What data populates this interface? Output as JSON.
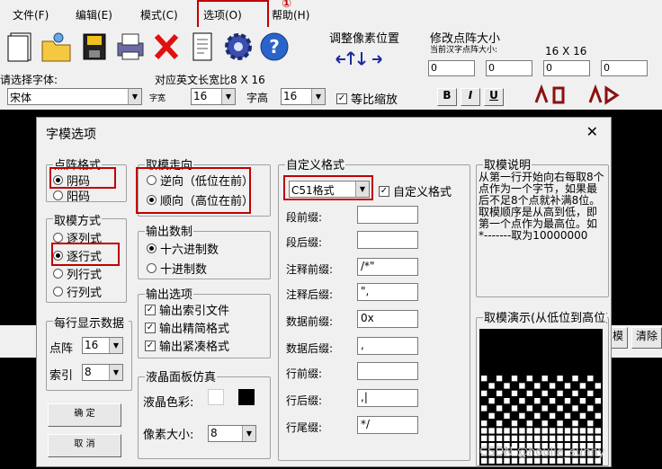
{
  "menu": {
    "items": [
      "文件(F)",
      "编辑(E)",
      "模式(C)",
      "选项(O)",
      "帮助(H)"
    ],
    "marker": "①"
  },
  "toolbar": {
    "font_prompt": "请选择字体:",
    "font_value": "宋体",
    "ratio_label": "对应英文长宽比8 X 16",
    "width_label": "字宽",
    "width_value": "16",
    "height_label": "字高",
    "height_value": "16",
    "keep_ratio_label": "等比缩放",
    "adjust_label": "调整像素位置",
    "dot_size_title": "修改点阵大小",
    "dot_size_sub": "当前汉字点阵大小:",
    "dot_size_value": "16 X 16",
    "spin_values": [
      "0",
      "0",
      "0",
      "0"
    ],
    "style_buttons": [
      "B",
      "I",
      "U"
    ]
  },
  "dialog": {
    "title": "字模选项",
    "close": "✕",
    "dot_format": {
      "title": "点阵格式",
      "options": [
        "阴码",
        "阳码"
      ]
    },
    "scan_mode": {
      "title": "取模方式",
      "options": [
        "逐列式",
        "逐行式",
        "列行式",
        "行列式"
      ]
    },
    "per_line": {
      "title": "每行显示数据",
      "dot_label": "点阵",
      "dot_value": "16",
      "index_label": "索引",
      "index_value": "8"
    },
    "direction": {
      "title": "取模走向",
      "options": [
        "逆向（低位在前）",
        "顺向（高位在前）"
      ]
    },
    "output_radix": {
      "title": "输出数制",
      "options": [
        "十六进制数",
        "十进制数"
      ]
    },
    "output_opts": {
      "title": "输出选项",
      "options": [
        "输出索引文件",
        "输出精简格式",
        "输出紧凑格式"
      ]
    },
    "lcd": {
      "title": "液晶面板仿真",
      "color_label": "液晶色彩:",
      "pixel_label": "像素大小:",
      "pixel_value": "8"
    },
    "custom": {
      "title": "自定义格式",
      "format_value": "C51格式",
      "check_label": "自定义格式",
      "fields": [
        {
          "label": "段前缀:",
          "value": ""
        },
        {
          "label": "段后缀:",
          "value": ""
        },
        {
          "label": "注释前缀:",
          "value": "/*\""
        },
        {
          "label": "注释后缀:",
          "value": "\","
        },
        {
          "label": "数据前缀:",
          "value": "0x"
        },
        {
          "label": "数据后缀:",
          "value": ","
        },
        {
          "label": "行前缀:",
          "value": ""
        },
        {
          "label": "行后缀:",
          "value": ",|"
        },
        {
          "label": "行尾缀:",
          "value": "*/"
        }
      ]
    },
    "explain": {
      "title": "取模说明",
      "text": "从第一行开始向右每取8个点作为一个字节，如果最后不足8个点就补满8位。取模顺序是从高到低，即第一个点作为最高位。如*-------取为10000000"
    },
    "preview": {
      "title": "取模演示(从低位到高位)"
    },
    "ok_button": "确  定",
    "cancel_button": "取  消"
  },
  "bottom": {
    "tab1": "模",
    "tab2": "清除"
  },
  "watermark": "CSDN @houlie_sunny"
}
